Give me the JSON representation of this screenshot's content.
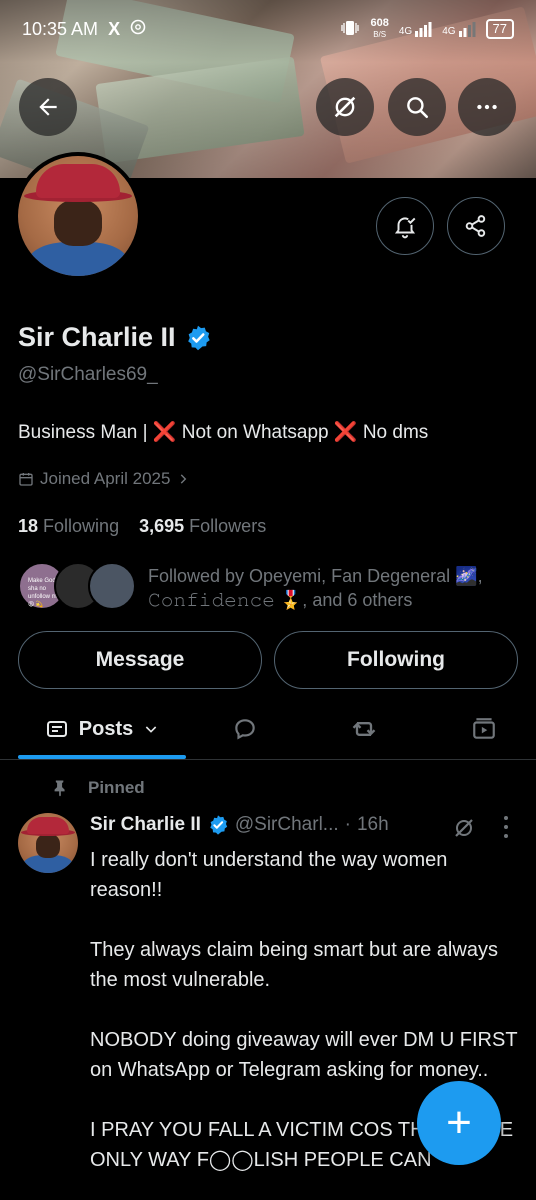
{
  "status_bar": {
    "time": "10:35 AM",
    "x_badge": "X",
    "data_rate": "608",
    "data_unit": "B/S",
    "net1": "4G",
    "net2": "4G",
    "battery": "77"
  },
  "header": {
    "back_icon": "arrow-left-icon",
    "grok_icon": "grok-icon",
    "search_icon": "search-icon",
    "more_icon": "more-horizontal-icon"
  },
  "profile": {
    "name": "Sir Charlie II",
    "handle": "@SirCharles69_",
    "bio_part1": "Business Man | ",
    "bio_x1": "❌",
    "bio_part2": " Not on Whatsapp ",
    "bio_x2": "❌",
    "bio_part3": " No dms",
    "joined": "Joined April 2025",
    "following_count": "18",
    "following_label": "Following",
    "followers_count": "3,695",
    "followers_label": "Followers",
    "followed_by_text": "Followed by Opeyemi, Fan Degeneral 🌌, 𝙲𝚘𝚗𝚏𝚒𝚍𝚎𝚗𝚌𝚎 🎖️, and 6 others",
    "mini_avatar_text": "Make God sha no unfollow me 😩 💫"
  },
  "actions": {
    "message_label": "Message",
    "following_button_label": "Following"
  },
  "tabs": {
    "posts_label": "Posts"
  },
  "tweet": {
    "pinned_label": "Pinned",
    "name": "Sir Charlie II",
    "handle": "@SirCharl...",
    "time_sep": "·",
    "time": "16h",
    "para1": "I really don't understand the way women reason!!",
    "para2": "They always claim being smart but are always the most vulnerable.",
    "para3": "NOBODY doing giveaway will ever DM U FIRST on WhatsApp or Telegram asking for money..",
    "para4": "I PRAY YOU FALL A VICTIM COS THIS IS THE ONLY WAY F◯◯LISH PEOPLE CAN"
  },
  "fab": {
    "label": "+"
  },
  "colors": {
    "accent": "#1d9bf0",
    "muted": "#71767b",
    "text": "#e7e9ea",
    "background": "#000000"
  }
}
